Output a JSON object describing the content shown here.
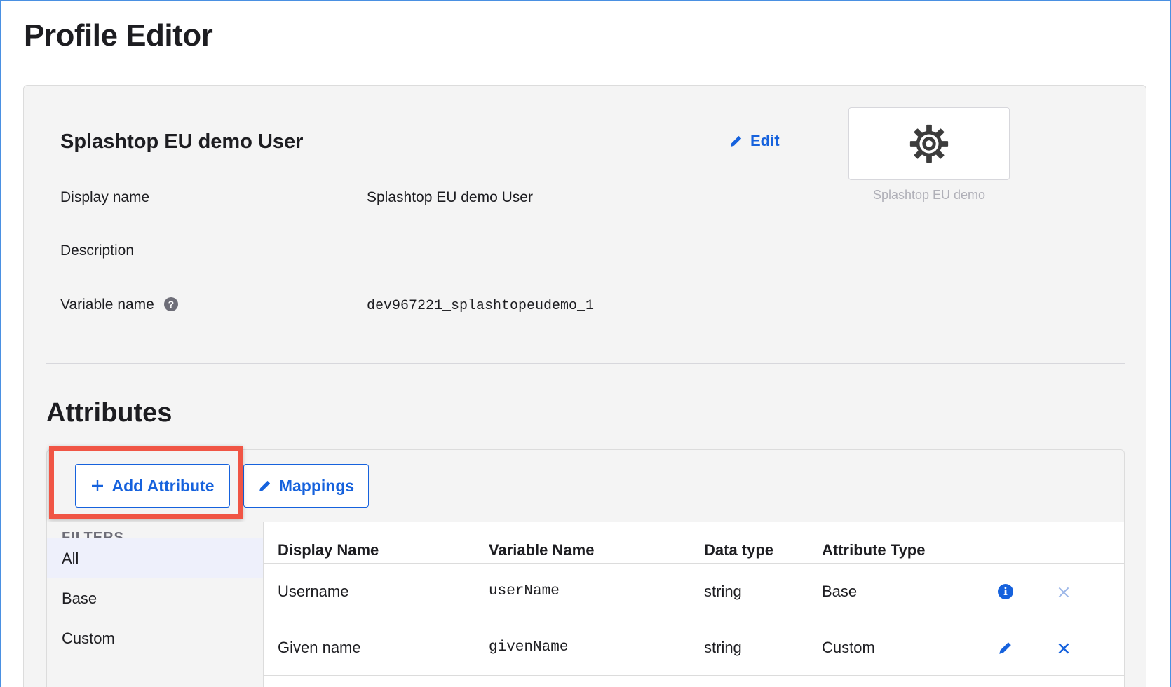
{
  "page": {
    "title": "Profile Editor"
  },
  "profile": {
    "name": "Splashtop EU demo User",
    "edit_label": "Edit",
    "fields": [
      {
        "label": "Display name",
        "value": "Splashtop EU demo User"
      },
      {
        "label": "Description",
        "value": ""
      },
      {
        "label": "Variable name",
        "value": "dev967221_splashtopeudemo_1"
      }
    ],
    "app_logo_caption": "Splashtop EU demo"
  },
  "attributes": {
    "title": "Attributes",
    "add_button_label": "Add Attribute",
    "mappings_button_label": "Mappings",
    "filters": {
      "title": "FILTERS",
      "items": [
        "All",
        "Base",
        "Custom"
      ],
      "active": "All"
    },
    "columns": [
      "Display Name",
      "Variable Name",
      "Data type",
      "Attribute Type"
    ],
    "rows": [
      {
        "display_name": "Username",
        "variable_name": "userName",
        "data_type": "string",
        "attribute_type": "Base",
        "action_icon": "info-icon",
        "remove_icon": "close-icon"
      },
      {
        "display_name": "Given name",
        "variable_name": "givenName",
        "data_type": "string",
        "attribute_type": "Custom",
        "action_icon": "pencil-icon",
        "remove_icon": "close-icon"
      }
    ]
  },
  "colors": {
    "accent": "#1662dd",
    "highlight": "#f05545",
    "panel_bg": "#f4f4f4"
  }
}
